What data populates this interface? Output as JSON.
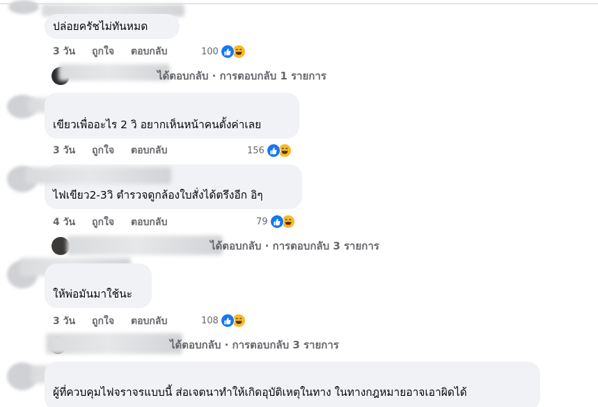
{
  "colors": {
    "bubble_bg": "#f0f2f5",
    "meta_text": "#65676b",
    "like_blue": "#1877f2",
    "haha_yellow": "#f7b928"
  },
  "comments": [
    {
      "text": "ปล่อยครัชไม่ทันหมด",
      "time": "3 วัน",
      "like_label": "ถูกใจ",
      "reply_label": "ตอบกลับ",
      "reaction_count": "100",
      "reaction_icons": [
        "like-icon",
        "haha-icon"
      ],
      "replies": "ได้ตอบกลับ · การตอบกลับ 1 รายการ"
    },
    {
      "text": "เขียวเพื่ออะไร 2 วิ อยากเห็นหน้าคนตั้งค่าเลย",
      "time": "3 วัน",
      "like_label": "ถูกใจ",
      "reply_label": "ตอบกลับ",
      "reaction_count": "156",
      "reaction_icons": [
        "like-icon",
        "haha-icon"
      ]
    },
    {
      "text": "ไฟเขียว2-3วิ ตำรวจดูกล้องใบสั่งได้ตรึงอีก อิๆ",
      "time": "4 วัน",
      "like_label": "ถูกใจ",
      "reply_label": "ตอบกลับ",
      "reaction_count": "79",
      "reaction_icons": [
        "like-icon",
        "haha-icon"
      ],
      "replies": "ได้ตอบกลับ · การตอบกลับ 3 รายการ"
    },
    {
      "text": "ให้พ่อมันมาใช้นะ",
      "time": "3 วัน",
      "like_label": "ถูกใจ",
      "reply_label": "ตอบกลับ",
      "reaction_count": "108",
      "reaction_icons": [
        "like-icon",
        "haha-icon"
      ],
      "replies": "ได้ตอบกลับ · การตอบกลับ 3 รายการ"
    },
    {
      "text": "ผู้ที่ควบคุมไฟจราจรแบบนี้ ส่อเจตนาทำให้เกิดอุบัติเหตุในทาง ในทางกฎหมายอาจเอาผิดได้"
    }
  ]
}
